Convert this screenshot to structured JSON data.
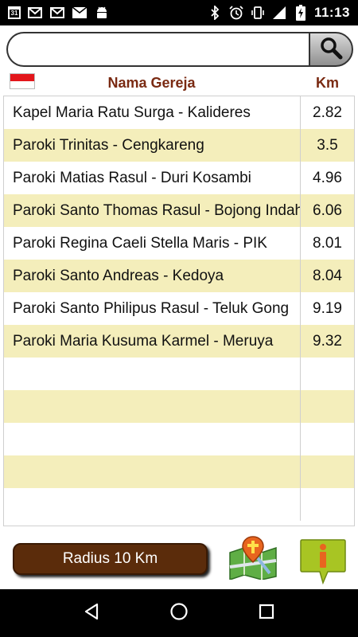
{
  "status_bar": {
    "calendar_day": "31",
    "time": "11:13",
    "left_icons": [
      "calendar-icon",
      "gmail-icon",
      "gmail-icon",
      "mail-icon",
      "android-debug-icon"
    ],
    "right_icons": [
      "bluetooth-icon",
      "alarm-icon",
      "vibrate-icon",
      "signal-icon",
      "battery-charging-icon"
    ]
  },
  "search": {
    "value": "",
    "placeholder": ""
  },
  "header": {
    "flag": "indonesia-flag",
    "name_label": "Nama Gereja",
    "km_label": "Km"
  },
  "rows": [
    {
      "name": "Kapel Maria Ratu Surga - Kalideres",
      "km": "2.82"
    },
    {
      "name": "Paroki Trinitas - Cengkareng",
      "km": "3.5"
    },
    {
      "name": "Paroki Matias Rasul - Duri Kosambi",
      "km": "4.96"
    },
    {
      "name": "Paroki Santo Thomas Rasul - Bojong Indah",
      "km": "6.06"
    },
    {
      "name": "Paroki Regina Caeli Stella Maris - PIK",
      "km": "8.01"
    },
    {
      "name": "Paroki Santo Andreas - Kedoya",
      "km": "8.04"
    },
    {
      "name": "Paroki Santo Philipus Rasul - Teluk Gong",
      "km": "9.19"
    },
    {
      "name": "Paroki Maria Kusuma Karmel - Meruya",
      "km": "9.32"
    },
    {
      "name": "",
      "km": ""
    },
    {
      "name": "",
      "km": ""
    },
    {
      "name": "",
      "km": ""
    },
    {
      "name": "",
      "km": ""
    },
    {
      "name": "",
      "km": ""
    }
  ],
  "footer": {
    "radius_label": "Radius 10 Km",
    "map_icon": "church-map-icon",
    "info_icon": "info-icon"
  },
  "colors": {
    "row_alt": "#f4eebb",
    "header_text": "#7a2a12",
    "radius_button": "#5b2c0b"
  }
}
